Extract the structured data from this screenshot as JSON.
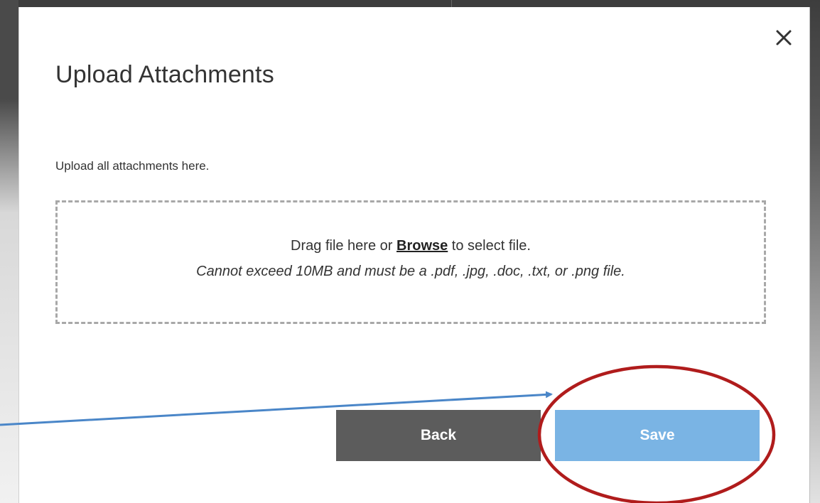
{
  "modal": {
    "title": "Upload Attachments",
    "intro": "Upload all attachments here.",
    "close_icon": "close-icon"
  },
  "dropzone": {
    "text_before": "Drag file here or ",
    "browse_label": "Browse",
    "text_after": " to select file.",
    "restriction": "Cannot exceed 10MB and must be a .pdf, .jpg, .doc, .txt, or .png file."
  },
  "buttons": {
    "back_label": "Back",
    "save_label": "Save"
  },
  "colors": {
    "back_button": "#5c5c5c",
    "save_button": "#7ab4e4",
    "annotation_ellipse": "#b01c1c",
    "annotation_arrow": "#4a86c8"
  }
}
